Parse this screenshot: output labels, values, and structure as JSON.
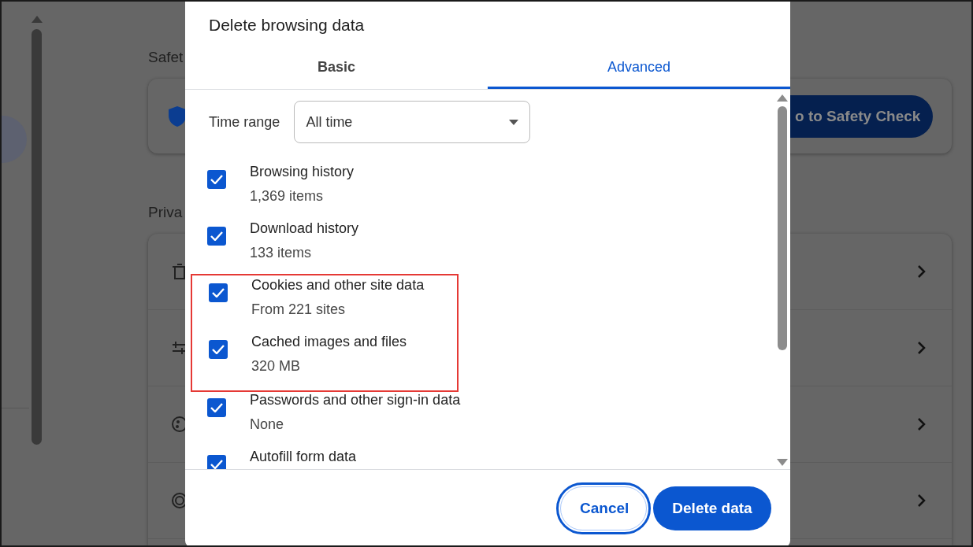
{
  "background": {
    "safety_heading": "Safet",
    "safety_button": "o to Safety Check",
    "privacy_heading": "Priva"
  },
  "dialog": {
    "title": "Delete browsing data",
    "tabs": [
      {
        "label": "Basic",
        "selected": false
      },
      {
        "label": "Advanced",
        "selected": true
      }
    ],
    "time_range": {
      "label": "Time range",
      "value": "All time"
    },
    "items": [
      {
        "title": "Browsing history",
        "detail": "1,369 items",
        "checked": true,
        "highlighted": false
      },
      {
        "title": "Download history",
        "detail": "133 items",
        "checked": true,
        "highlighted": false
      },
      {
        "title": "Cookies and other site data",
        "detail": "From 221 sites",
        "checked": true,
        "highlighted": true
      },
      {
        "title": "Cached images and files",
        "detail": "320 MB",
        "checked": true,
        "highlighted": true
      },
      {
        "title": "Passwords and other sign-in data",
        "detail": "None",
        "checked": true,
        "highlighted": false
      },
      {
        "title": "Autofill form data",
        "checked": true,
        "highlighted": false
      }
    ],
    "buttons": [
      {
        "label": "Cancel",
        "kind": "secondary",
        "focused": true
      },
      {
        "label": "Delete data",
        "kind": "primary",
        "focused": false
      }
    ]
  }
}
